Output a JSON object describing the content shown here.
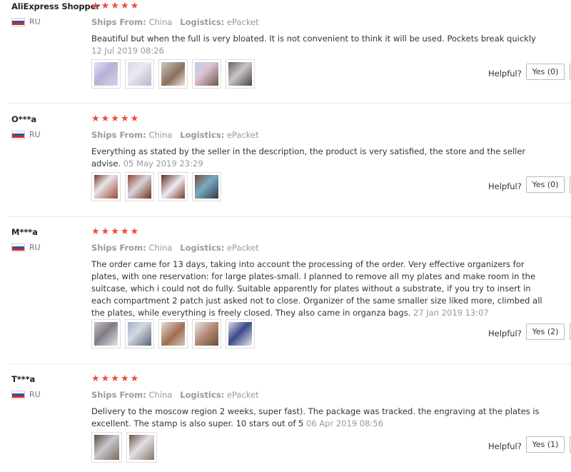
{
  "reviews": [
    {
      "user": "AliExpress Shopper",
      "country": "RU",
      "stars": "★★★★★",
      "ships_label": "Ships From:",
      "ships_value": "China",
      "logistics_label": "Logistics:",
      "logistics_value": "ePacket",
      "text": "Beautiful but when the full is very bloated. It is not convenient to think it will be used. Pockets break quickly ",
      "date": "12 Jul 2019 08:26",
      "photo_count": 5,
      "helpful_label": "Helpful?",
      "yes_label": "Yes (0)"
    },
    {
      "user": "O***a",
      "country": "RU",
      "stars": "★★★★★",
      "ships_label": "Ships From:",
      "ships_value": "China",
      "logistics_label": "Logistics:",
      "logistics_value": "ePacket",
      "text": "Everything as stated by the seller in the description, the product is very satisfied, the store and the seller advise. ",
      "date": "05 May 2019 23:29",
      "photo_count": 4,
      "helpful_label": "Helpful?",
      "yes_label": "Yes (0)"
    },
    {
      "user": "M***a",
      "country": "RU",
      "stars": "★★★★★",
      "ships_label": "Ships From:",
      "ships_value": "China",
      "logistics_label": "Logistics:",
      "logistics_value": "ePacket",
      "text": "The order came for 13 days, taking into account the processing of the order. Very effective organizers for plates, with one reservation: for large plates-small. I planned to remove all my plates and make room in the suitcase, which i could not do fully. Suitable apparently for plates without a substrate, if you try to insert in each compartment 2 patch just asked not to close. Organizer of the same smaller size liked more, climbed all the plates, while everything is freely closed. They also came in organza bags. ",
      "date": "27 Jan 2019 13:07",
      "photo_count": 5,
      "helpful_label": "Helpful?",
      "yes_label": "Yes (2)"
    },
    {
      "user": "T***a",
      "country": "RU",
      "stars": "★★★★★",
      "ships_label": "Ships From:",
      "ships_value": "China",
      "logistics_label": "Logistics:",
      "logistics_value": "ePacket",
      "text": "Delivery to the moscow region 2 weeks, super fast). The package was tracked. the engraving at the plates is excellent. The stamp is also super. 10 stars out of 5 ",
      "date": "06 Apr 2019 08:56",
      "photo_count": 2,
      "helpful_label": "Helpful?",
      "yes_label": "Yes (1)"
    }
  ],
  "colors": {
    "star": "#f04a3a",
    "muted": "#999999",
    "flag_white": "#ffffff",
    "flag_blue": "#2b55b0",
    "flag_red": "#d52b1e"
  }
}
